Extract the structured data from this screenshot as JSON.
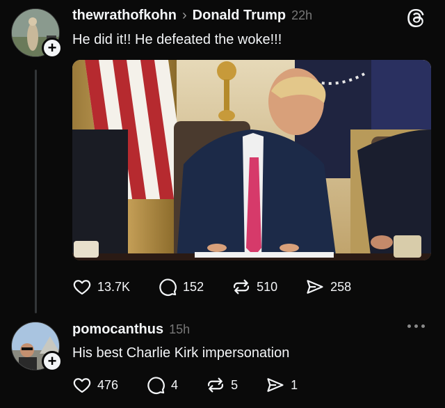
{
  "post": {
    "username": "thewrathofkohn",
    "reply_to": "Donald Trump",
    "time": "22h",
    "text": "He did it!! He defeated the woke!!!",
    "plus": "+",
    "stats": {
      "likes": "13.7K",
      "replies": "152",
      "reposts": "510",
      "shares": "258"
    }
  },
  "reply": {
    "username": "pomocanthus",
    "time": "15h",
    "text": "His best Charlie Kirk impersonation",
    "plus": "+",
    "stats": {
      "likes": "476",
      "replies": "4",
      "reposts": "5",
      "shares": "1"
    }
  },
  "icons": {
    "like": "heart-icon",
    "reply": "comment-icon",
    "repost": "repost-icon",
    "share": "send-icon",
    "app": "threads-logo-icon",
    "more": "more-icon"
  },
  "colors": {
    "background": "#0a0a0a",
    "text": "#f3f5f7",
    "muted": "#777777",
    "thread_line": "#333638"
  }
}
